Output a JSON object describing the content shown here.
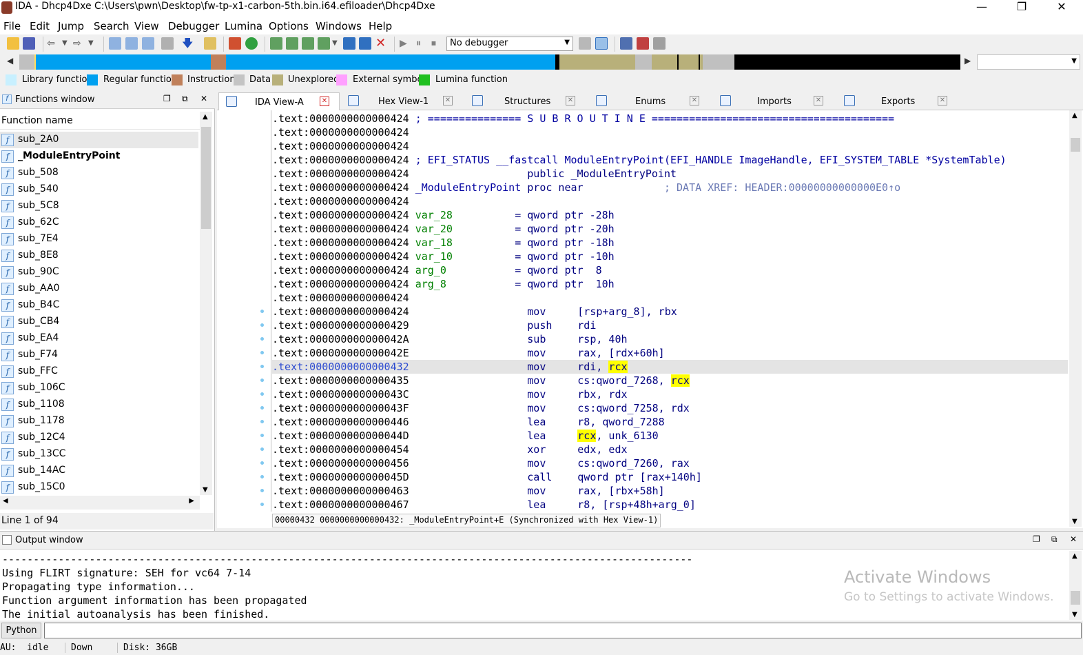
{
  "window": {
    "title": "IDA - Dhcp4Dxe C:\\Users\\pwn\\Desktop\\fw-tp-x1-carbon-5th.bin.i64.efiloader\\Dhcp4Dxe",
    "minimize": "—",
    "maximize": "❐",
    "close": "✕"
  },
  "menu": [
    "File",
    "Edit",
    "Jump",
    "Search",
    "View",
    "Debugger",
    "Lumina",
    "Options",
    "Windows",
    "Help"
  ],
  "toolbar": {
    "debugger_select": "No debugger"
  },
  "legend": [
    {
      "label": "Library function",
      "color": "#c8f0ff"
    },
    {
      "label": "Regular function",
      "color": "#00a0f0"
    },
    {
      "label": "Instruction",
      "color": "#c0805a"
    },
    {
      "label": "Data",
      "color": "#c4c4c4"
    },
    {
      "label": "Unexplored",
      "color": "#b8b07a"
    },
    {
      "label": "External symbol",
      "color": "#ffa0ff"
    },
    {
      "label": "Lumina function",
      "color": "#20c020"
    }
  ],
  "functions_window": {
    "title": "Functions window",
    "column": "Function name",
    "items": [
      "sub_2A0",
      "_ModuleEntryPoint",
      "sub_508",
      "sub_540",
      "sub_5C8",
      "sub_62C",
      "sub_7E4",
      "sub_8E8",
      "sub_90C",
      "sub_AA0",
      "sub_B4C",
      "sub_CB4",
      "sub_EA4",
      "sub_F74",
      "sub_FFC",
      "sub_106C",
      "sub_1108",
      "sub_1178",
      "sub_12C4",
      "sub_13CC",
      "sub_14AC",
      "sub_15C0"
    ],
    "status": "Line 1 of 94"
  },
  "tabs": [
    {
      "label": "IDA View-A",
      "close": "✕"
    },
    {
      "label": "Hex View-1",
      "close": "✕"
    },
    {
      "label": "Structures",
      "close": "✕"
    },
    {
      "label": "Enums",
      "close": "✕"
    },
    {
      "label": "Imports",
      "close": "✕"
    },
    {
      "label": "Exports",
      "close": "✕"
    }
  ],
  "disasm": {
    "lines": [
      {
        "addr": ".text:0000000000000424",
        "rest": " ; =============== S U B R O U T I N E ======================================="
      },
      {
        "addr": ".text:0000000000000424",
        "rest": ""
      },
      {
        "addr": ".text:0000000000000424",
        "rest": ""
      },
      {
        "addr": ".text:0000000000000424",
        "rest": " ; EFI_STATUS __fastcall ModuleEntryPoint(EFI_HANDLE ImageHandle, EFI_SYSTEM_TABLE *SystemTable)"
      },
      {
        "addr": ".text:0000000000000424",
        "rest": "                   public _ModuleEntryPoint"
      },
      {
        "addr": ".text:0000000000000424",
        "label": "_ModuleEntryPoint",
        "rest": " proc near             ",
        "xref": "; DATA XREF: HEADER:00000000000000E0↑o"
      },
      {
        "addr": ".text:0000000000000424",
        "rest": ""
      },
      {
        "addr": ".text:0000000000000424",
        "var": "var_28",
        "rest": "          = qword ptr -28h"
      },
      {
        "addr": ".text:0000000000000424",
        "var": "var_20",
        "rest": "          = qword ptr -20h"
      },
      {
        "addr": ".text:0000000000000424",
        "var": "var_18",
        "rest": "          = qword ptr -18h"
      },
      {
        "addr": ".text:0000000000000424",
        "var": "var_10",
        "rest": "          = qword ptr -10h"
      },
      {
        "addr": ".text:0000000000000424",
        "var": "arg_0",
        "rest": "           = qword ptr  8"
      },
      {
        "addr": ".text:0000000000000424",
        "var": "arg_8",
        "rest": "           = qword ptr  10h"
      },
      {
        "addr": ".text:0000000000000424",
        "rest": ""
      },
      {
        "addr": ".text:0000000000000424",
        "mnem": "mov",
        "ops": "[rsp+arg_8], rbx"
      },
      {
        "addr": ".text:0000000000000429",
        "mnem": "push",
        "ops": "rdi"
      },
      {
        "addr": ".text:000000000000042A",
        "mnem": "sub",
        "ops": "rsp, 40h"
      },
      {
        "addr": ".text:000000000000042E",
        "mnem": "mov",
        "ops": "rax, [rdx+60h]"
      },
      {
        "addr": ".text:0000000000000432",
        "mnem": "mov",
        "ops": "rdi, ",
        "hl_reg": "rcx"
      },
      {
        "addr": ".text:0000000000000435",
        "mnem": "mov",
        "ops": "cs:qword_7268, ",
        "hl_reg": "rcx"
      },
      {
        "addr": ".text:000000000000043C",
        "mnem": "mov",
        "ops": "rbx, rdx"
      },
      {
        "addr": ".text:000000000000043F",
        "mnem": "mov",
        "ops": "cs:qword_7258, rdx"
      },
      {
        "addr": ".text:0000000000000446",
        "mnem": "lea",
        "ops": "r8, qword_7288"
      },
      {
        "addr": ".text:000000000000044D",
        "mnem": "lea",
        "ops_pre": "rcx",
        "ops": ", unk_6130"
      },
      {
        "addr": ".text:0000000000000454",
        "mnem": "xor",
        "ops": "edx, edx"
      },
      {
        "addr": ".text:0000000000000456",
        "mnem": "mov",
        "ops": "cs:qword_7260, rax"
      },
      {
        "addr": ".text:000000000000045D",
        "mnem": "call",
        "ops": "qword ptr [rax+140h]"
      },
      {
        "addr": ".text:0000000000000463",
        "mnem": "mov",
        "ops": "rax, [rbx+58h]"
      },
      {
        "addr": ".text:0000000000000467",
        "mnem": "lea",
        "ops": "r8, [rsp+48h+arg_0]"
      }
    ],
    "status": "00000432 0000000000000432: _ModuleEntryPoint+E (Synchronized with Hex View-1)"
  },
  "output_window": {
    "title": "Output window",
    "lines": [
      "---------------------------------------------------------------------------------------------------------------",
      "Using FLIRT signature: SEH for vc64 7-14",
      "Propagating type information...",
      "Function argument information has been propagated",
      "The initial autoanalysis has been finished."
    ],
    "watermark_title": "Activate Windows",
    "watermark_sub": "Go to Settings to activate Windows."
  },
  "python_button": "Python",
  "statusbar": {
    "au": "AU:  idle",
    "dir": "Down",
    "disk": "Disk: 36GB"
  }
}
